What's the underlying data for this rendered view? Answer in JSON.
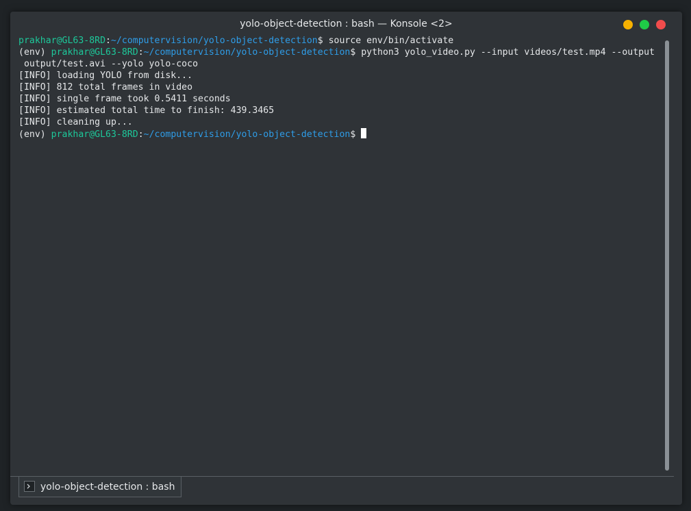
{
  "window": {
    "title": "yolo-object-detection : bash — Konsole <2>"
  },
  "terminal": {
    "lines": [
      [
        {
          "t": "prakhar@GL63-8RD",
          "c": "green"
        },
        {
          "t": ":",
          "c": ""
        },
        {
          "t": "~/computervision/yolo-object-detection",
          "c": "blue"
        },
        {
          "t": "$ source env/bin/activate",
          "c": ""
        }
      ],
      [
        {
          "t": "(env) ",
          "c": ""
        },
        {
          "t": "prakhar@GL63-8RD",
          "c": "green"
        },
        {
          "t": ":",
          "c": ""
        },
        {
          "t": "~/computervision/yolo-object-detection",
          "c": "blue"
        },
        {
          "t": "$ python3 yolo_video.py --input videos/test.mp4 --output",
          "c": ""
        }
      ],
      [
        {
          "t": " output/test.avi --yolo yolo-coco",
          "c": ""
        }
      ],
      [
        {
          "t": "[INFO] loading YOLO from disk...",
          "c": ""
        }
      ],
      [
        {
          "t": "[INFO] 812 total frames in video",
          "c": ""
        }
      ],
      [
        {
          "t": "[INFO] single frame took 0.5411 seconds",
          "c": ""
        }
      ],
      [
        {
          "t": "[INFO] estimated total time to finish: 439.3465",
          "c": ""
        }
      ],
      [
        {
          "t": "[INFO] cleaning up...",
          "c": ""
        }
      ],
      [
        {
          "t": "(env) ",
          "c": ""
        },
        {
          "t": "prakhar@GL63-8RD",
          "c": "green"
        },
        {
          "t": ":",
          "c": ""
        },
        {
          "t": "~/computervision/yolo-object-detection",
          "c": "blue"
        },
        {
          "t": "$ ",
          "c": ""
        }
      ]
    ],
    "colors": {
      "green": "#1dc89a",
      "blue": "#2f9de8",
      "text": "#e5e7e9"
    }
  },
  "tabs": [
    {
      "label": "yolo-object-detection : bash",
      "icon": "terminal-icon"
    }
  ]
}
